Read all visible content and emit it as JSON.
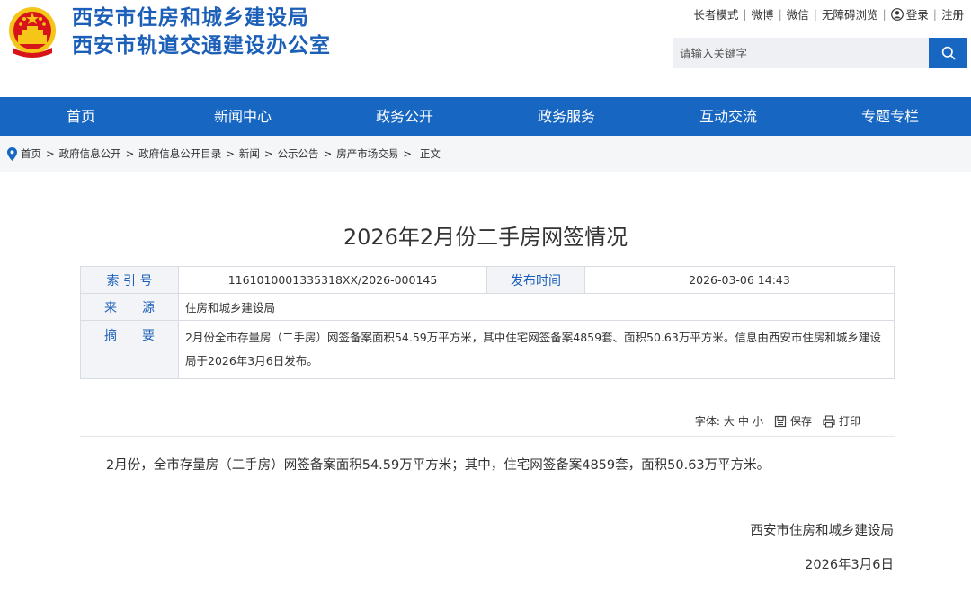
{
  "header": {
    "title_line1": "西安市住房和城乡建设局",
    "title_line2": "西安市轨道交通建设办公室",
    "emblem_icon": "national-emblem-icon",
    "toplinks": [
      "长者模式",
      "微博",
      "微信",
      "无障碍浏览"
    ],
    "login": "登录",
    "register": "注册",
    "search_placeholder": "请输入关键字"
  },
  "nav": [
    "首页",
    "新闻中心",
    "政务公开",
    "政务服务",
    "互动交流",
    "专题专栏"
  ],
  "breadcrumb": [
    "首页",
    "政府信息公开",
    "政府信息公开目录",
    "新闻",
    "公示公告",
    "房产市场交易",
    "正文"
  ],
  "article": {
    "title": "2026年2月份二手房网签情况",
    "meta": {
      "index_label": "索 引 号",
      "index_value": "1161010001335318XX/2026-000145",
      "date_label": "发布时间",
      "date_value": "2026-03-06 14:43",
      "source_label": "来　　源",
      "source_value": "住房和城乡建设局",
      "abstract_label": "摘　　要",
      "abstract_value": "2月份全市存量房（二手房）网签备案面积54.59万平方米，其中住宅网签备案4859套、面积50.63万平方米。信息由西安市住房和城乡建设局于2026年3月6日发布。"
    },
    "tools": {
      "font_label": "字体:",
      "sizes": [
        "大",
        "中",
        "小"
      ],
      "save": "保存",
      "print": "打印"
    },
    "body": "2月份，全市存量房（二手房）网签备案面积54.59万平方米；其中，住宅网签备案4859套，面积50.63万平方米。",
    "signature": "西安市住房和城乡建设局",
    "sign_date": "2026年3月6日"
  },
  "colors": {
    "brand_blue": "#1666c2",
    "title_blue": "#1b5fb8",
    "emblem_red": "#d7141a",
    "emblem_gold": "#f5c518"
  }
}
